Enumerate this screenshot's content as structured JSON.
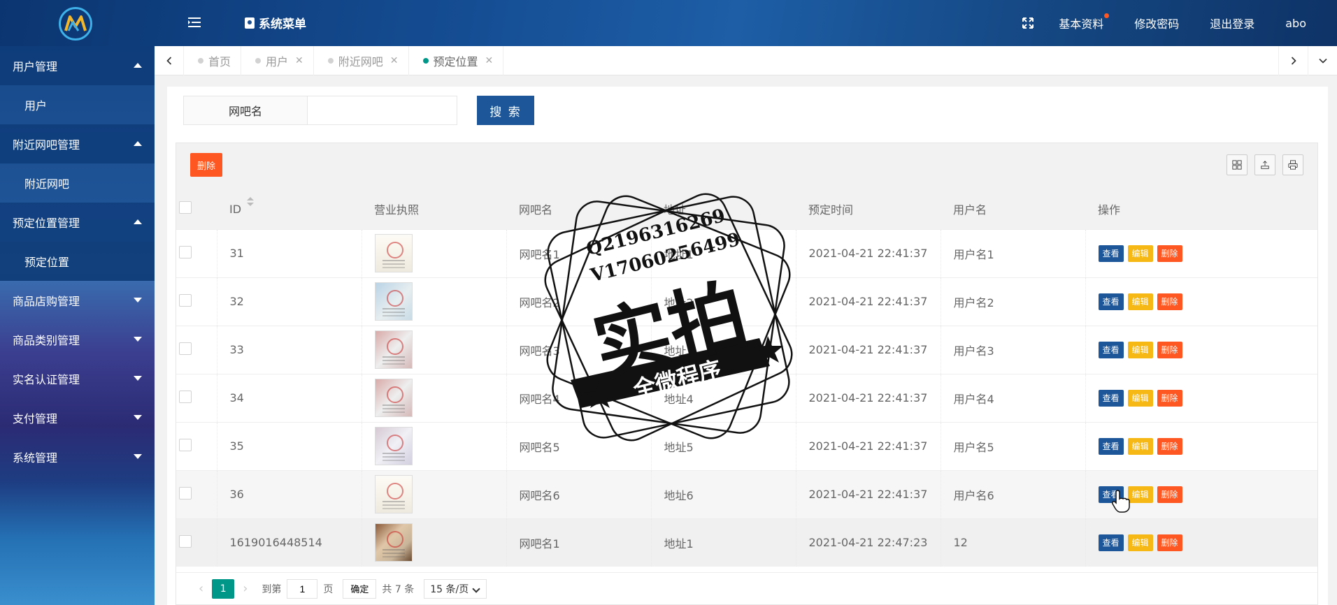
{
  "header": {
    "menu_title": "系统菜单",
    "links": [
      "基本资料",
      "修改密码",
      "退出登录"
    ],
    "username": "abo"
  },
  "sidebar": {
    "groups": [
      {
        "label": "用户管理",
        "open": true,
        "items": [
          "用户"
        ]
      },
      {
        "label": "附近网吧管理",
        "open": true,
        "items": [
          "附近网吧"
        ]
      },
      {
        "label": "预定位置管理",
        "open": true,
        "items": [
          "预定位置"
        ]
      },
      {
        "label": "商品店购管理",
        "open": false,
        "items": []
      },
      {
        "label": "商品类别管理",
        "open": false,
        "items": []
      },
      {
        "label": "实名认证管理",
        "open": false,
        "items": []
      },
      {
        "label": "支付管理",
        "open": false,
        "items": []
      },
      {
        "label": "系统管理",
        "open": false,
        "items": []
      }
    ]
  },
  "tabs": [
    {
      "label": "首页",
      "closable": false,
      "active": false
    },
    {
      "label": "用户",
      "closable": true,
      "active": false
    },
    {
      "label": "附近网吧",
      "closable": true,
      "active": false
    },
    {
      "label": "预定位置",
      "closable": true,
      "active": true
    }
  ],
  "search": {
    "label": "网吧名",
    "value": "",
    "button": "搜 索"
  },
  "toolbar": {
    "delete_label": "删除"
  },
  "table": {
    "headers": [
      "ID",
      "营业执照",
      "网吧名",
      "地址",
      "预定时间",
      "用户名",
      "操作"
    ],
    "rows": [
      {
        "id": "31",
        "name": "网吧名1",
        "addr": "地址1",
        "time": "2021-04-21 22:41:37",
        "user": "用户名1"
      },
      {
        "id": "32",
        "name": "网吧名2",
        "addr": "地址2",
        "time": "2021-04-21 22:41:37",
        "user": "用户名2"
      },
      {
        "id": "33",
        "name": "网吧名3",
        "addr": "地址3",
        "time": "2021-04-21 22:41:37",
        "user": "用户名3"
      },
      {
        "id": "34",
        "name": "网吧名4",
        "addr": "地址4",
        "time": "2021-04-21 22:41:37",
        "user": "用户名4"
      },
      {
        "id": "35",
        "name": "网吧名5",
        "addr": "地址5",
        "time": "2021-04-21 22:41:37",
        "user": "用户名5"
      },
      {
        "id": "36",
        "name": "网吧名6",
        "addr": "地址6",
        "time": "2021-04-21 22:41:37",
        "user": "用户名6"
      },
      {
        "id": "1619016448514",
        "name": "网吧名1",
        "addr": "地址1",
        "time": "2021-04-21 22:47:23",
        "user": "12"
      }
    ],
    "actions": {
      "view": "查看",
      "edit": "编辑",
      "delete": "删除"
    }
  },
  "pager": {
    "current": "1",
    "goto_prefix": "到第",
    "goto_value": "1",
    "goto_suffix": "页",
    "confirm": "确定",
    "total": "共 7 条",
    "page_size": "15 条/页"
  },
  "watermark": {
    "line1": "Q2196316269",
    "line2": "V17060256499",
    "big": "实拍",
    "banner": "全微程序"
  },
  "colors": {
    "primary": "#1e5799",
    "danger": "#ff5722",
    "warning": "#f5b814",
    "active_tab": "#009688"
  }
}
